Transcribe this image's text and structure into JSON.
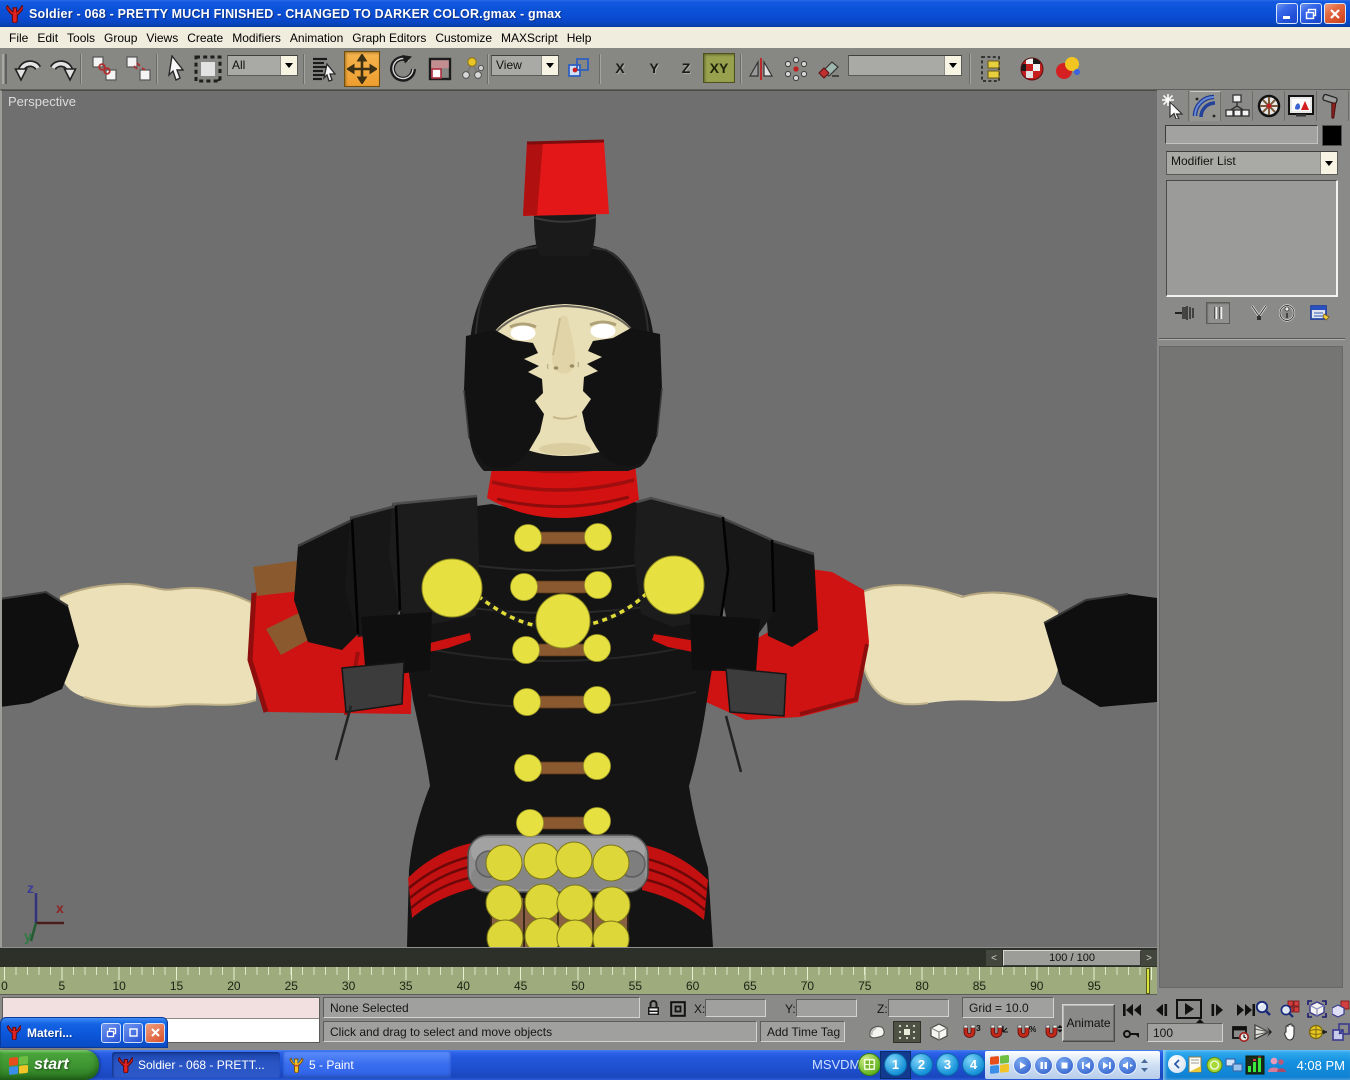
{
  "window": {
    "title": "Soldier - 068 - PRETTY MUCH FINISHED - CHANGED TO DARKER COLOR.gmax - gmax",
    "minimize": "",
    "restore": "",
    "close": ""
  },
  "menu": {
    "items": [
      "File",
      "Edit",
      "Tools",
      "Group",
      "Views",
      "Create",
      "Modifiers",
      "Animation",
      "Graph Editors",
      "Customize",
      "MAXScript",
      "Help"
    ]
  },
  "toolbar": {
    "selection_filter_value": "All",
    "coord_system_value": "View",
    "named_selection_value": "",
    "axis_x": "X",
    "axis_y": "Y",
    "axis_z": "Z",
    "axis_xy": "XY"
  },
  "viewport": {
    "label": "Perspective",
    "axis_x": "x",
    "axis_y": "y",
    "axis_z": "z"
  },
  "timeline": {
    "frame_display": "100 / 100",
    "prev_arrow": "<",
    "next_arrow": ">",
    "ticks": [
      "0",
      "5",
      "10",
      "15",
      "20",
      "25",
      "30",
      "35",
      "40",
      "45",
      "50",
      "55",
      "60",
      "65",
      "70",
      "75",
      "80",
      "85",
      "90",
      "95"
    ]
  },
  "command_panel": {
    "modifier_list_value": "Modifier List"
  },
  "status": {
    "selection": "None Selected",
    "prompt": "Click and drag to select and move objects",
    "add_time_tag": "Add Time Tag",
    "grid": "Grid = 10.0",
    "x_label": "X:",
    "y_label": "Y:",
    "z_label": "Z:",
    "x_value": "",
    "y_value": "",
    "z_value": "",
    "animate": "Animate",
    "frame_value": "100"
  },
  "material_window": {
    "title": "Materi..."
  },
  "taskbar": {
    "start": "start",
    "task_gmax": "Soldier - 068 - PRETT...",
    "task_paint": "5 - Paint",
    "msvdm": "MSVDM",
    "desktops": [
      "1",
      "2",
      "3",
      "4"
    ],
    "clock": "4:08 PM"
  },
  "colors": {
    "titlebar_blue": "#0b51d8",
    "taskbar_blue": "#1e50d0",
    "start_green": "#3d9430",
    "viewport_gray": "#6f6f6f",
    "ui_gray": "#8a8a88",
    "ruler_olive": "#9dab7d",
    "active_tool_orange": "#f0a436",
    "active_axis_green": "#98a24e",
    "crest_red": "#d91414",
    "armor_black": "#151515",
    "skin_tan": "#e9deb4",
    "disc_yellow": "#e4de3d",
    "strap_brown": "#8a5a2e",
    "close_button_red": "#d9512a"
  }
}
